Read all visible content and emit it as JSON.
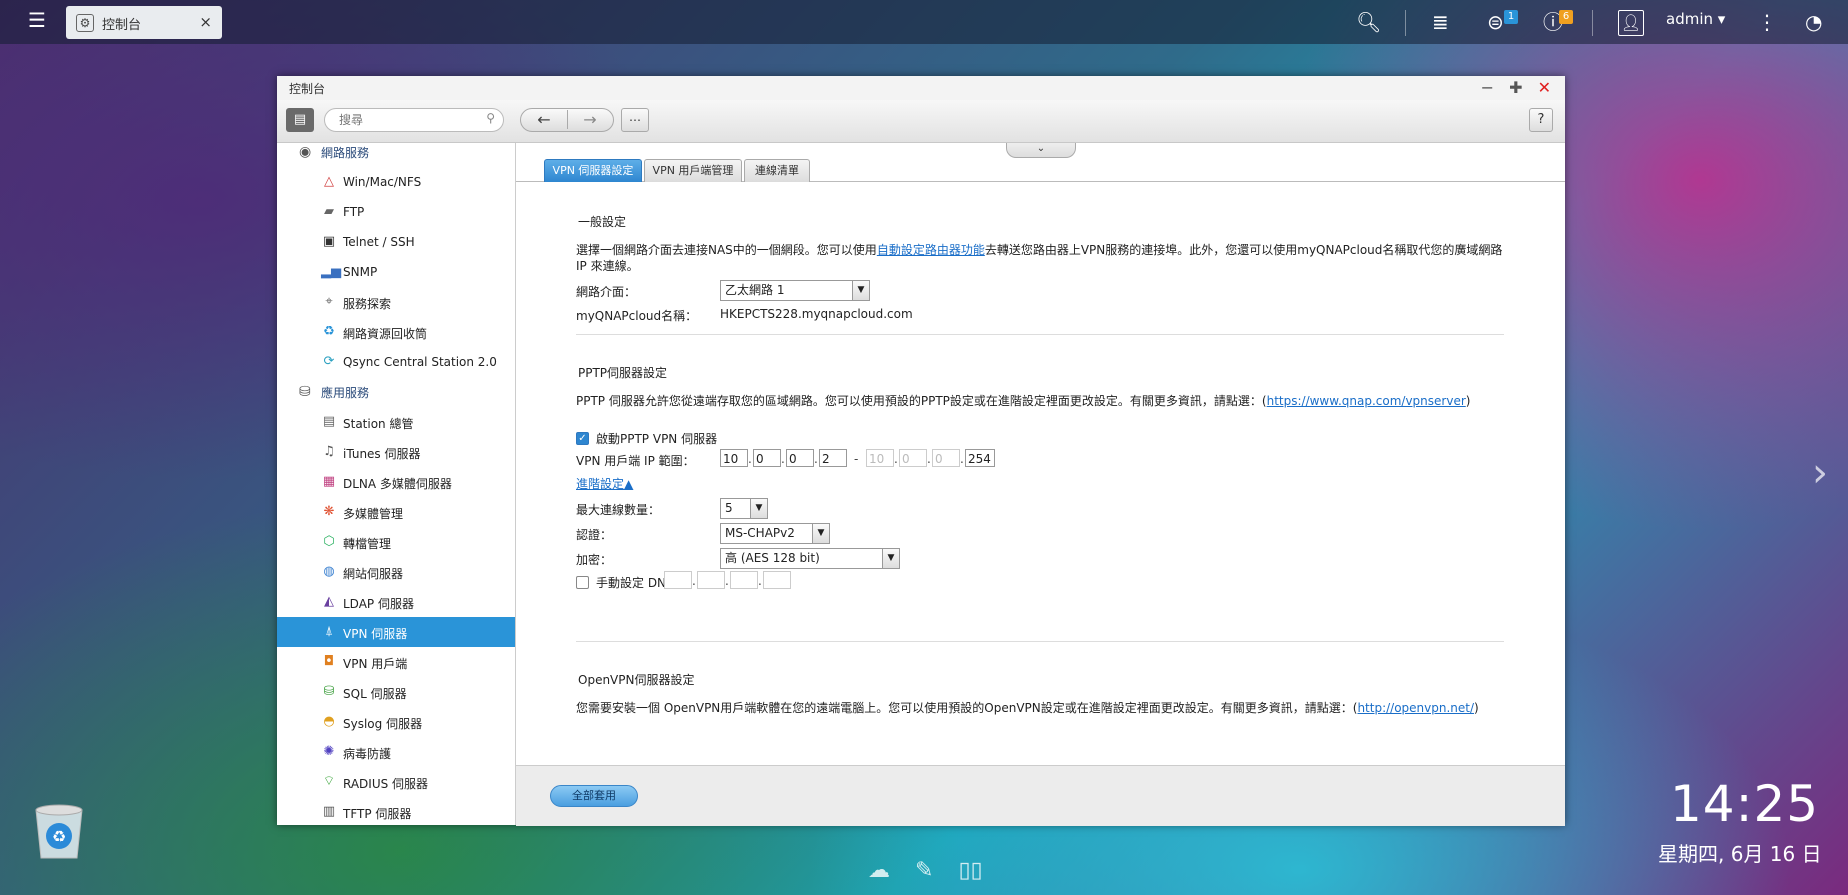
{
  "topbar": {
    "tab_label": "控制台",
    "badge_counts": [
      "1",
      "6"
    ],
    "user": "admin",
    "badge_colors": [
      "#2a94d8",
      "#f0a020"
    ]
  },
  "window": {
    "title": "控制台",
    "search_placeholder": "搜尋",
    "help_label": "?"
  },
  "sidebar": {
    "categories": [
      {
        "label": "網路服務",
        "icon": "network-services-icon"
      },
      {
        "label": "應用服務",
        "icon": "applications-icon"
      }
    ],
    "network_items": [
      {
        "label": "Win/Mac/NFS"
      },
      {
        "label": "FTP"
      },
      {
        "label": "Telnet / SSH"
      },
      {
        "label": "SNMP"
      },
      {
        "label": "服務探索"
      },
      {
        "label": "網路資源回收筒"
      },
      {
        "label": "Qsync Central Station 2.0"
      }
    ],
    "app_items": [
      {
        "label": "Station 總管"
      },
      {
        "label": "iTunes 伺服器"
      },
      {
        "label": "DLNA 多媒體伺服器"
      },
      {
        "label": "多媒體管理"
      },
      {
        "label": "轉檔管理"
      },
      {
        "label": "網站伺服器"
      },
      {
        "label": "LDAP 伺服器"
      },
      {
        "label": "VPN 伺服器"
      },
      {
        "label": "VPN 用戶端"
      },
      {
        "label": "SQL 伺服器"
      },
      {
        "label": "Syslog 伺服器"
      },
      {
        "label": "病毒防護"
      },
      {
        "label": "RADIUS 伺服器"
      },
      {
        "label": "TFTP 伺服器"
      }
    ]
  },
  "tabs": [
    "VPN 伺服器設定",
    "VPN 用戶端管理",
    "連線清單"
  ],
  "general": {
    "title": "一般設定",
    "desc_before": "選擇一個網路介面去連接NAS中的一個網段。您可以使用",
    "desc_link": "自動設定路由器功能",
    "desc_after": "去轉送您路由器上VPN服務的連接埠。此外，您還可以使用myQNAPcloud名稱取代您的廣域網路IP 來連線。",
    "interface_label": "網路介面：",
    "interface_value": "乙太網路 1",
    "cloud_label": "myQNAPcloud名稱：",
    "cloud_value": "HKEPCTS228.myqnapcloud.com"
  },
  "pptp": {
    "title": "PPTP伺服器設定",
    "desc_before": "PPTP 伺服器允許您從遠端存取您的區域網路。您可以使用預設的PPTP設定或在進階設定裡面更改設定。有關更多資訊，請點選：(",
    "desc_link": "https://www.qnap.com/vpnserver",
    "desc_after": ")",
    "enable_label": "啟動PPTP VPN 伺服器",
    "range_label": "VPN 用戶端 IP 範圍：",
    "ip_start": [
      "10",
      "0",
      "0",
      "2"
    ],
    "ip_end": [
      "10",
      "0",
      "0",
      "254"
    ],
    "range_dash": "-",
    "advanced_label": "進階設定▲",
    "max_conn_label": "最大連線數量：",
    "max_conn_value": "5",
    "auth_label": "認證：",
    "auth_value": "MS-CHAPv2",
    "enc_label": "加密：",
    "enc_value": "高 (AES 128 bit)",
    "dns_label": "手動設定 DNS："
  },
  "openvpn": {
    "title": "OpenVPN伺服器設定",
    "desc_before": "您需要安裝一個 OpenVPN用戶端軟體在您的遠端電腦上。您可以使用預設的OpenVPN設定或在進階設定裡面更改設定。有關更多資訊，請點選：(",
    "desc_link": "http://openvpn.net/",
    "desc_after": ")"
  },
  "footer": {
    "apply_label": "全部套用"
  },
  "desktop": {
    "time": "14:25",
    "date": "星期四, 6月 16 日"
  }
}
